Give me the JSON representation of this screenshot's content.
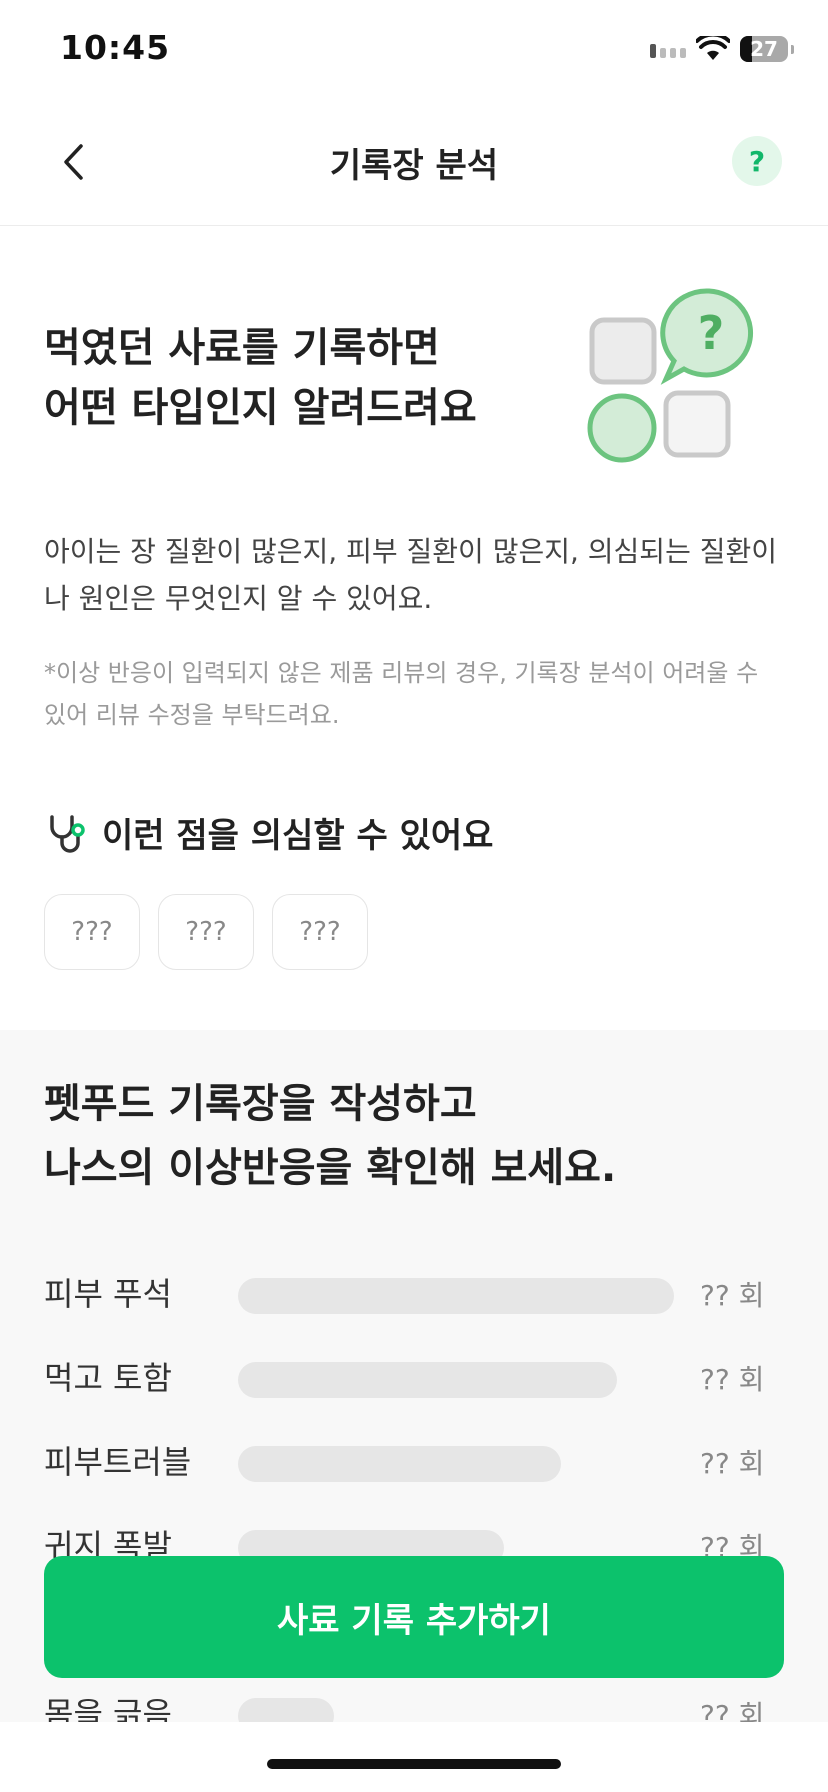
{
  "status_bar": {
    "time": "10:45",
    "battery": "27"
  },
  "header": {
    "title": "기록장 분석",
    "help_label": "?"
  },
  "intro": {
    "heading_line1": "먹였던 사료를 기록하면",
    "heading_line2": "어떤 타입인지 알려드려요",
    "illustration_label": "?",
    "description": "아이는 장 질환이 많은지, 피부 질환이 많은지, 의심되는 질환이나 원인은 무엇인지 알 수 있어요.",
    "note": "*이상 반응이 입력되지 않은 제품 리뷰의 경우, 기록장 분석이 어려울 수 있어 리뷰 수정을 부탁드려요."
  },
  "suspect": {
    "title": "이런 점을 의심할 수 있어요",
    "chips": [
      "???",
      "???",
      "???"
    ]
  },
  "record": {
    "heading_line1": "펫푸드 기록장을 작성하고",
    "heading_line2": "나스의 이상반응을 확인해 보세요.",
    "reactions": [
      {
        "label": "피부 푸석",
        "count": "?? 회",
        "level": 1.0
      },
      {
        "label": "먹고 토함",
        "count": "?? 회",
        "level": 0.87
      },
      {
        "label": "피부트러블",
        "count": "?? 회",
        "level": 0.74
      },
      {
        "label": "귀지 폭발",
        "count": "?? 회",
        "level": 0.61
      },
      {
        "label": "",
        "count": "",
        "level": 0.48
      },
      {
        "label": "",
        "count": "",
        "level": 0.35
      },
      {
        "label": "몸을 긁음",
        "count": "?? 회",
        "level": 0.22
      }
    ]
  },
  "cta": {
    "label": "사료 기록 추가하기"
  },
  "colors": {
    "accent": "#0cc26c",
    "accent_light": "#e3f7ea",
    "illustration_green": "#6cc47f"
  }
}
